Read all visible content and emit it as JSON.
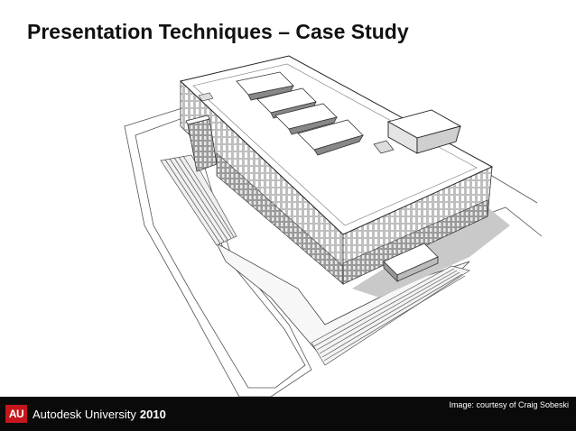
{
  "slide": {
    "title": "Presentation Techniques – Case Study",
    "illustration": "building-model-illustration"
  },
  "footer": {
    "logo_mark": "AU",
    "logo_name": "Autodesk University",
    "logo_year": "2010",
    "credit": "Image: courtesy of Craig Sobeski",
    "background_color": "#0a0a0a",
    "brand_color": "#c4161c"
  }
}
